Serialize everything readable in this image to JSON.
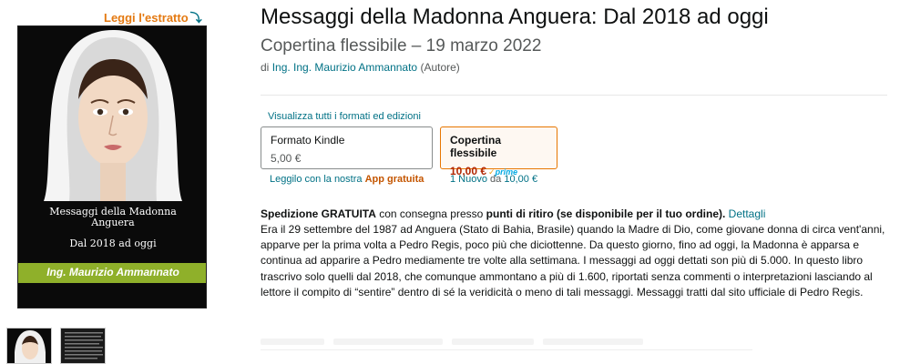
{
  "look_inside": {
    "label": "Leggi l'estratto",
    "arrow": "⤵"
  },
  "cover": {
    "title": "Messaggi della Madonna Anguera",
    "subtitle": "Dal 2018 ad oggi",
    "author": "Ing. Maurizio Ammannato",
    "band_color": "#8fb02a"
  },
  "product": {
    "title": "Messaggi della Madonna Anguera: Dal 2018 ad oggi",
    "subtitle": "Copertina flessibile – 19 marzo 2022",
    "by_prefix": "di",
    "author": "Ing. Ing. Maurizio Ammannato",
    "role": "(Autore)"
  },
  "formats": {
    "view_all": "Visualizza tutti i formati ed edizioni",
    "kindle": {
      "name": "Formato Kindle",
      "price": "5,00 €",
      "below_text": "Leggilo con la nostra",
      "below_app": "App gratuita"
    },
    "paperback": {
      "name": "Copertina flessibile",
      "price": "10,00 €",
      "prime_check": "✓",
      "prime_label": "prime",
      "offers_link": "1 Nuovo",
      "offers_from": "da",
      "offers_price": "10,00 €"
    }
  },
  "shipping": {
    "label": "Spedizione GRATUITA",
    "middle": "con consegna presso",
    "bold": "punti di ritiro (se disponibile per il tuo ordine).",
    "details_link": "Dettagli"
  },
  "description": "Era il 29 settembre del 1987 ad Anguera (Stato di Bahia, Brasile) quando la Madre di Dio, come giovane donna di circa vent'anni, apparve per la prima volta a Pedro Regis, poco più che diciottenne. Da questo giorno, fino ad oggi, la Madonna è apparsa e continua ad apparire a Pedro mediamente tre volte alla settimana. I messaggi ad oggi dettati son più di 5.000. In questo libro trascrivo solo quelli dal 2018, che comunque ammontano a più di 1.600, riportati senza commenti o interpretazioni lasciando al lettore il compito di “sentire” dentro di sé la veridicità o meno di tali messaggi. Messaggi tratti dal sito ufficiale di Pedro Regis.",
  "colors": {
    "link": "#007185",
    "price": "#b12704",
    "selected_border": "#e77600",
    "look_inside": "#e47911"
  }
}
